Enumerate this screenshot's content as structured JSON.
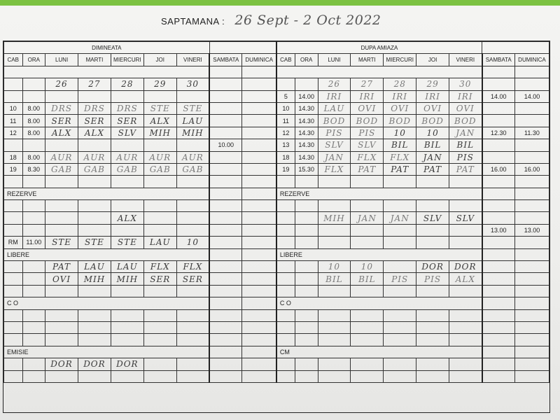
{
  "title": {
    "label": "SAPTAMANA :",
    "handwritten": "26 Sept - 2 Oct 2022"
  },
  "sections": {
    "morning": "DIMINEATA",
    "afternoon": "DUPA AMIAZA"
  },
  "headers": {
    "cab": "CAB",
    "ora": "ORA",
    "luni": "LUNI",
    "marti": "MARTI",
    "miercuri": "MIERCURI",
    "joi": "JOI",
    "vineri": "VINERI",
    "sambata": "SAMBATA",
    "duminica": "DUMINICA"
  },
  "dates": [
    "26",
    "27",
    "28",
    "29",
    "30"
  ],
  "labels": {
    "rezerve": "REZERVE",
    "libere": "LIBERE",
    "co": "C O",
    "emisie": "EMISIE",
    "cm": "CM"
  },
  "rows": {
    "r5": {
      "pm": [
        "5",
        "14.00",
        "IRI",
        "IRI",
        "IRI",
        "IRI",
        "IRI",
        "14.00",
        "14.00"
      ]
    },
    "r10": {
      "am": [
        "10",
        "8.00",
        "DRS",
        "DRS",
        "DRS",
        "STE",
        "STE"
      ],
      "pm": [
        "10",
        "14.30",
        "LAU",
        "OVI",
        "OVI",
        "OVI",
        "OVI",
        "",
        ""
      ]
    },
    "r11": {
      "am": [
        "11",
        "8.00",
        "SER",
        "SER",
        "SER",
        "ALX",
        "LAU"
      ],
      "pm": [
        "11",
        "14.30",
        "BOD",
        "BOD",
        "BOD",
        "BOD",
        "BOD",
        "",
        ""
      ]
    },
    "r12": {
      "am": [
        "12",
        "8.00",
        "ALX",
        "ALX",
        "SLV",
        "MIH",
        "MIH"
      ],
      "pm": [
        "12",
        "14.30",
        "PIS",
        "PIS",
        "10",
        "10",
        "JAN",
        "12.30",
        "11.30"
      ]
    },
    "r13": {
      "am_sat": "10.00",
      "pm": [
        "13",
        "14.30",
        "SLV",
        "SLV",
        "BIL",
        "BIL",
        "BIL",
        "",
        ""
      ]
    },
    "r18": {
      "am": [
        "18",
        "8.00",
        "AUR",
        "AUR",
        "AUR",
        "AUR",
        "AUR"
      ],
      "pm": [
        "18",
        "14.30",
        "JAN",
        "FLX",
        "FLX",
        "JAN",
        "PIS",
        "",
        ""
      ]
    },
    "r19": {
      "am": [
        "19",
        "8.30",
        "GAB",
        "GAB",
        "GAB",
        "GAB",
        "GAB"
      ],
      "pm": [
        "19",
        "15.30",
        "FLX",
        "PAT",
        "PAT",
        "PAT",
        "PAT",
        "16.00",
        "16.00"
      ]
    }
  },
  "rezerve": {
    "am_row": [
      "",
      "",
      "ALX",
      "",
      ""
    ],
    "pm_row": [
      "MIH",
      "JAN",
      "JAN",
      "SLV",
      "SLV"
    ],
    "rm": [
      "RM",
      "11.00",
      "STE",
      "STE",
      "STE",
      "LAU",
      "10"
    ],
    "pm_sat": "13.00",
    "pm_sun": "13.00"
  },
  "libere": {
    "am1": [
      "PAT",
      "LAU",
      "LAU",
      "FLX",
      "FLX"
    ],
    "am2": [
      "OVI",
      "MIH",
      "MIH",
      "SER",
      "SER"
    ],
    "pm1": [
      "10",
      "10",
      "",
      "DOR",
      "DOR"
    ],
    "pm2": [
      "BIL",
      "BIL",
      "PIS",
      "PIS",
      "ALX"
    ]
  },
  "emisie": {
    "am": [
      "DOR",
      "DOR",
      "DOR",
      "",
      ""
    ]
  }
}
